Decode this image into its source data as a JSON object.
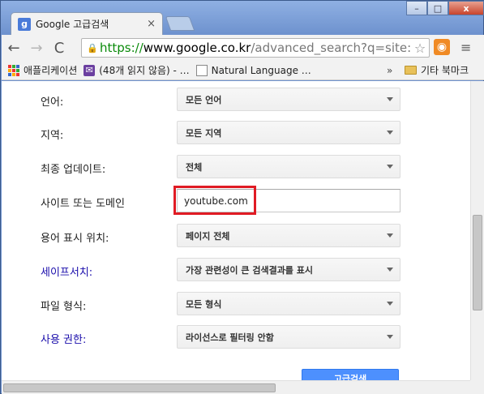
{
  "window": {
    "tab_title": "Google 고급검색",
    "favicon_letter": "g",
    "tab_close": "×",
    "controls": {
      "minimize": "–",
      "maximize": "□",
      "close": "x"
    }
  },
  "toolbar": {
    "back_icon": "←",
    "forward_icon": "→",
    "reload_icon": "C",
    "url_scheme": "https://",
    "url_host": "www.google.co.kr",
    "url_rest": "/advanced_search?q=site:y",
    "star_icon": "☆",
    "menu_icon": "≡"
  },
  "bookmarks": {
    "apps": "애플리케이션",
    "mail": "(48개 읽지 않음) - …",
    "doc": "Natural Language …",
    "overflow": "»",
    "folder": "기타 북마크"
  },
  "form": {
    "rows": [
      {
        "label": "언어:",
        "value": "모든 언어",
        "type": "select",
        "link": false
      },
      {
        "label": "지역:",
        "value": "모든 지역",
        "type": "select",
        "link": false
      },
      {
        "label": "최종 업데이트:",
        "value": "전체",
        "type": "select",
        "link": false
      },
      {
        "label": "사이트 또는 도메인",
        "value": "youtube.com",
        "type": "text",
        "link": false
      },
      {
        "label": "용어 표시 위치:",
        "value": "페이지 전체",
        "type": "select",
        "link": false
      },
      {
        "label": "세이프서치:",
        "value": "가장 관련성이 큰 검색결과를 표시",
        "type": "select",
        "link": true
      },
      {
        "label": "파일 형식:",
        "value": "모든 형식",
        "type": "select",
        "link": false
      },
      {
        "label": "사용 권한:",
        "value": "라이선스로 필터링 안함",
        "type": "select",
        "link": true
      }
    ],
    "submit_label": "고급검색"
  },
  "colors": {
    "link": "#1a0dab",
    "highlight": "#e01b24",
    "submit": "#4d90fe"
  }
}
